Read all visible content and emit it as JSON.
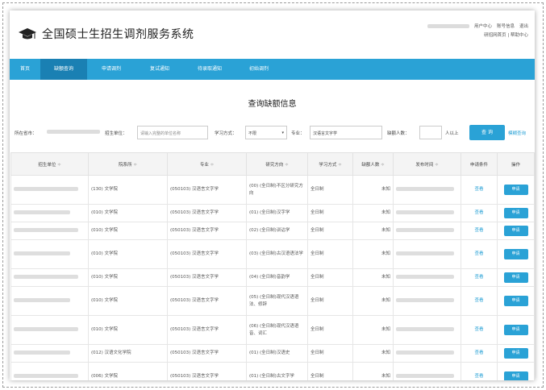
{
  "header": {
    "title": "全国硕士生招生调剂服务系统",
    "links_row1": [
      "用户中心",
      "账号信息",
      "退出"
    ],
    "links_row2": [
      "研招网首页",
      "|",
      "帮助中心"
    ]
  },
  "nav": {
    "items": [
      {
        "label": "首页",
        "active": false
      },
      {
        "label": "缺额查询",
        "active": true
      },
      {
        "label": "申请调剂",
        "active": false
      },
      {
        "label": "复试通知",
        "active": false
      },
      {
        "label": "待录取通知",
        "active": false
      },
      {
        "label": "初始调剂",
        "active": false
      }
    ]
  },
  "page_heading": "查询缺额信息",
  "filters": {
    "location_label": "所在省市：",
    "school_label": "招生单位：",
    "school_placeholder": "请输入完整的单位名称",
    "mode_label": "学习方式：",
    "mode_value": "不限",
    "major_label": "专业：",
    "major_value": "汉语言文字学",
    "quota_label": "缺额人数：",
    "quota_suffix": "人以上",
    "search_label": "查 询",
    "advanced_label": "模糊查询"
  },
  "table": {
    "headers": [
      "招生单位",
      "院系所",
      "专业",
      "研究方向",
      "学习方式",
      "缺额人数",
      "发布时间",
      "申请条件",
      "操作"
    ],
    "sort_mark": "≑",
    "view_label": "查看",
    "apply_label": "申请",
    "rows": [
      {
        "dept": "(130) 文学院",
        "major": "(050103) 汉语言文字学",
        "direction": "(00) (全日制)不区分研究方向",
        "mode": "全日制",
        "quota": "未知",
        "tall": true
      },
      {
        "dept": "(010) 文学院",
        "major": "(050103) 汉语言文字学",
        "direction": "(01) (全日制)汉字学",
        "mode": "全日制",
        "quota": "未知",
        "tall": false
      },
      {
        "dept": "(010) 文学院",
        "major": "(050103) 汉语言文字学",
        "direction": "(02) (全日制)训诂学",
        "mode": "全日制",
        "quota": "未知",
        "tall": false
      },
      {
        "dept": "(010) 文学院",
        "major": "(050103) 汉语言文字学",
        "direction": "(03) (全日制)古汉语语法学",
        "mode": "全日制",
        "quota": "未知",
        "tall": true
      },
      {
        "dept": "(010) 文学院",
        "major": "(050103) 汉语言文字学",
        "direction": "(04) (全日制)音韵学",
        "mode": "全日制",
        "quota": "未知",
        "tall": false
      },
      {
        "dept": "(010) 文学院",
        "major": "(050103) 汉语言文字学",
        "direction": "(05) (全日制)现代汉语语法、修辞",
        "mode": "全日制",
        "quota": "未知",
        "tall": true
      },
      {
        "dept": "(010) 文学院",
        "major": "(050103) 汉语言文字学",
        "direction": "(06) (全日制)现代汉语语音、词汇",
        "mode": "全日制",
        "quota": "未知",
        "tall": true
      },
      {
        "dept": "(012) 汉语文化学院",
        "major": "(050103) 汉语言文字学",
        "direction": "(01) (全日制)汉语史",
        "mode": "全日制",
        "quota": "未知",
        "tall": false
      },
      {
        "dept": "(006) 文学院",
        "major": "(050103) 汉语言文字学",
        "direction": "(01) (全日制)古文字学",
        "mode": "全日制",
        "quota": "未知",
        "tall": true
      }
    ]
  }
}
